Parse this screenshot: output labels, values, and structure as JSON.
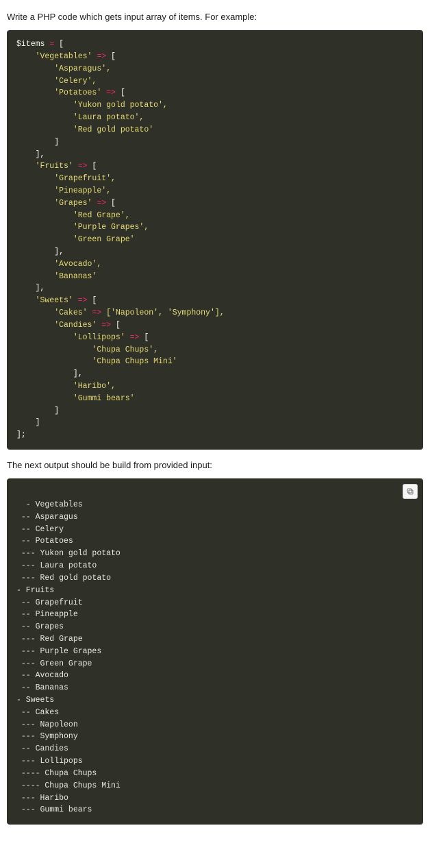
{
  "intro_text": "Write a PHP code which gets input array of items. For example:",
  "php_code": {
    "l01": "$items ",
    "l01_eq": "=",
    "l01_after": " [",
    "l02_key": "    'Vegetables' ",
    "l02_arrow": "=>",
    "l02_after": " [",
    "l03": "        'Asparagus',",
    "l04": "        'Celery',",
    "l05_key": "        'Potatoes' ",
    "l05_arrow": "=>",
    "l05_after": " [",
    "l06": "            'Yukon gold potato',",
    "l07": "            'Laura potato',",
    "l08": "            'Red gold potato'",
    "l09": "        ]",
    "l10": "    ],",
    "l11_key": "    'Fruits' ",
    "l11_arrow": "=>",
    "l11_after": " [",
    "l12": "        'Grapefruit',",
    "l13": "        'Pineapple',",
    "l14_key": "        'Grapes' ",
    "l14_arrow": "=>",
    "l14_after": " [",
    "l15": "            'Red Grape',",
    "l16": "            'Purple Grapes',",
    "l17": "            'Green Grape'",
    "l18": "        ],",
    "l19": "        'Avocado',",
    "l20": "        'Bananas'",
    "l21": "    ],",
    "l22_key": "    'Sweets' ",
    "l22_arrow": "=>",
    "l22_after": " [",
    "l23_key": "        'Cakes' ",
    "l23_arrow": "=>",
    "l23_after": " ['Napoleon', 'Symphony'],",
    "l24_key": "        'Candies' ",
    "l24_arrow": "=>",
    "l24_after": " [",
    "l25_key": "            'Lollipops' ",
    "l25_arrow": "=>",
    "l25_after": " [",
    "l26": "                'Chupa Chups',",
    "l27": "                'Chupa Chups Mini'",
    "l28": "            ],",
    "l29": "            'Haribo',",
    "l30": "            'Gummi bears'",
    "l31": "        ]",
    "l32": "    ]",
    "l33": "];"
  },
  "middle_text": "The next output should be build from provided input:",
  "output_lines": [
    "- Vegetables",
    " -- Asparagus",
    " -- Celery",
    " -- Potatoes",
    " --- Yukon gold potato",
    " --- Laura potato",
    " --- Red gold potato",
    "- Fruits",
    " -- Grapefruit",
    " -- Pineapple",
    " -- Grapes",
    " --- Red Grape",
    " --- Purple Grapes",
    " --- Green Grape",
    " -- Avocado",
    " -- Bananas",
    "- Sweets",
    " -- Cakes",
    " --- Napoleon",
    " --- Symphony",
    " -- Candies",
    " --- Lollipops",
    " ---- Chupa Chups",
    " ---- Chupa Chups Mini",
    " --- Haribo",
    " --- Gummi bears"
  ]
}
